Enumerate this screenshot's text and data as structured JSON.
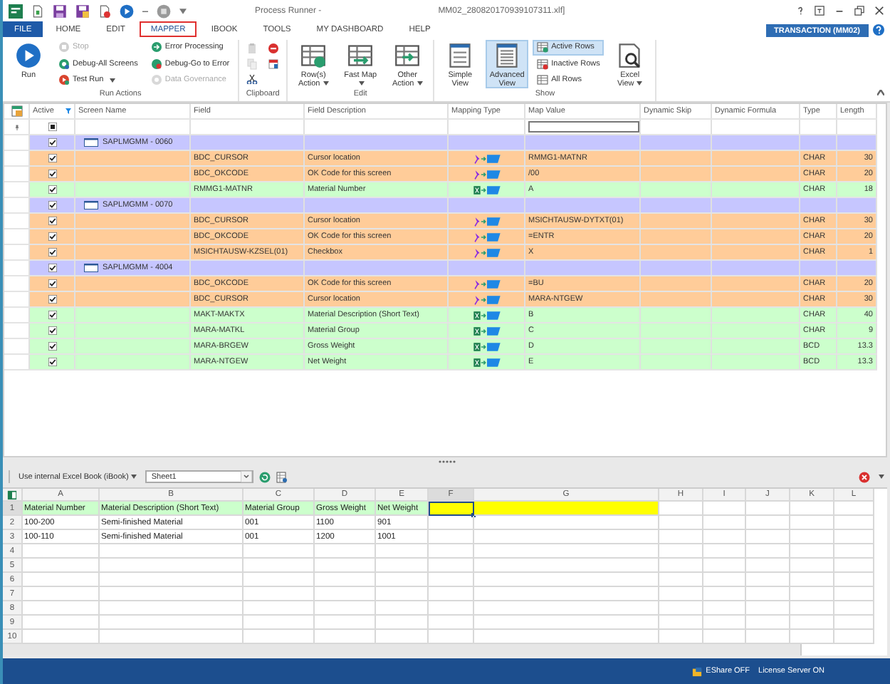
{
  "window": {
    "title": "Process Runner -",
    "document": "MM02_280820170939107311.xlf]"
  },
  "tabs": [
    {
      "label": "FILE",
      "kind": "file",
      "selected": false
    },
    {
      "label": "HOME",
      "kind": "tab",
      "selected": false
    },
    {
      "label": "EDIT",
      "kind": "tab",
      "selected": false
    },
    {
      "label": "MAPPER",
      "kind": "tab",
      "selected": true
    },
    {
      "label": "IBOOK",
      "kind": "tab",
      "selected": false
    },
    {
      "label": "TOOLS",
      "kind": "tab",
      "selected": false
    },
    {
      "label": "MY DASHBOARD",
      "kind": "tab",
      "selected": false
    },
    {
      "label": "HELP",
      "kind": "tab",
      "selected": false
    }
  ],
  "transaction": "TRANSACTION (MM02)",
  "ribbon": {
    "groups": [
      {
        "label": "Run Actions",
        "items": [
          {
            "kind": "big",
            "label": "Run"
          },
          {
            "kind": "small",
            "label": "Stop",
            "disabled": true
          },
          {
            "kind": "small",
            "label": "Debug-All Screens",
            "disabled": false
          },
          {
            "kind": "small",
            "label": "Test Run",
            "disabled": false,
            "caret": true
          },
          {
            "kind": "small",
            "label": "Error Processing",
            "disabled": false
          },
          {
            "kind": "small",
            "label": "Debug-Go to Error",
            "disabled": false
          },
          {
            "kind": "small",
            "label": "Data Governance",
            "disabled": true
          }
        ]
      },
      {
        "label": "Clipboard",
        "items": [
          {
            "kind": "icon",
            "disabled": true
          },
          {
            "kind": "icon",
            "disabled": true
          },
          {
            "kind": "icon",
            "disabled": false
          },
          {
            "kind": "icon",
            "disabled": false
          },
          {
            "kind": "icon",
            "disabled": false
          }
        ]
      },
      {
        "label": "Edit",
        "items": [
          {
            "kind": "big",
            "label": "Row(s) Action",
            "caret": true
          },
          {
            "kind": "big",
            "label": "Fast Map",
            "caret": true
          },
          {
            "kind": "big",
            "label": "Other Action",
            "caret": true
          }
        ]
      },
      {
        "label": "Show",
        "items": [
          {
            "kind": "big",
            "label": "Simple View",
            "selected": false
          },
          {
            "kind": "big",
            "label": "Advanced View",
            "selected": true
          },
          {
            "kind": "small",
            "label": "Active Rows",
            "selected": true
          },
          {
            "kind": "small",
            "label": "Inactive Rows",
            "selected": false
          },
          {
            "kind": "small",
            "label": "All Rows",
            "selected": false
          },
          {
            "kind": "big",
            "label": "Excel View",
            "caret": true,
            "selected": false
          }
        ]
      }
    ]
  },
  "grid": {
    "columns": [
      "Active",
      "Screen Name",
      "Field",
      "Field Description",
      "Mapping Type",
      "Map Value",
      "Dynamic Skip",
      "Dynamic Formula",
      "Type",
      "Length"
    ],
    "rows": [
      {
        "kind": "screen",
        "active": true,
        "screen": "SAPLMGMM - 0060"
      },
      {
        "kind": "constant",
        "active": true,
        "field": "BDC_CURSOR",
        "description": "Cursor location",
        "value": "RMMG1-MATNR",
        "type": "CHAR",
        "length": "30"
      },
      {
        "kind": "constant",
        "active": true,
        "field": "BDC_OKCODE",
        "description": "OK Code for this screen",
        "value": "/00",
        "type": "CHAR",
        "length": "20"
      },
      {
        "kind": "excel",
        "active": true,
        "field": "RMMG1-MATNR",
        "description": "Material Number",
        "value": "A",
        "type": "CHAR",
        "length": "18"
      },
      {
        "kind": "screen",
        "active": true,
        "screen": "SAPLMGMM - 0070"
      },
      {
        "kind": "constant",
        "active": true,
        "field": "BDC_CURSOR",
        "description": "Cursor location",
        "value": "MSICHTAUSW-DYTXT(01)",
        "type": "CHAR",
        "length": "30"
      },
      {
        "kind": "constant",
        "active": true,
        "field": "BDC_OKCODE",
        "description": "OK Code for this screen",
        "value": "=ENTR",
        "type": "CHAR",
        "length": "20"
      },
      {
        "kind": "constant",
        "active": true,
        "field": "MSICHTAUSW-KZSEL(01)",
        "description": "Checkbox",
        "value": "X",
        "type": "CHAR",
        "length": "1"
      },
      {
        "kind": "screen",
        "active": true,
        "screen": "SAPLMGMM - 4004"
      },
      {
        "kind": "constant",
        "active": true,
        "field": "BDC_OKCODE",
        "description": "OK Code for this screen",
        "value": "=BU",
        "type": "CHAR",
        "length": "20"
      },
      {
        "kind": "constant",
        "active": true,
        "field": "BDC_CURSOR",
        "description": "Cursor location",
        "value": "MARA-NTGEW",
        "type": "CHAR",
        "length": "30"
      },
      {
        "kind": "excel",
        "active": true,
        "field": "MAKT-MAKTX",
        "description": "Material Description (Short Text)",
        "value": "B",
        "type": "CHAR",
        "length": "40"
      },
      {
        "kind": "excel",
        "active": true,
        "field": "MARA-MATKL",
        "description": "Material Group",
        "value": "C",
        "type": "CHAR",
        "length": "9"
      },
      {
        "kind": "excel",
        "active": true,
        "field": "MARA-BRGEW",
        "description": "Gross Weight",
        "value": "D",
        "type": "BCD",
        "length": "13.3"
      },
      {
        "kind": "excel",
        "active": true,
        "field": "MARA-NTGEW",
        "description": "Net Weight",
        "value": "E",
        "type": "BCD",
        "length": "13.3"
      }
    ]
  },
  "sheet_toolbar": {
    "source": "Use internal Excel Book (iBook)",
    "sheet": "Sheet1"
  },
  "sheet": {
    "columns": [
      {
        "label": "A",
        "selected": false
      },
      {
        "label": "B",
        "selected": false
      },
      {
        "label": "C",
        "selected": false
      },
      {
        "label": "D",
        "selected": false
      },
      {
        "label": "E",
        "selected": false
      },
      {
        "label": "F",
        "selected": true
      },
      {
        "label": "G",
        "selected": false
      },
      {
        "label": "H",
        "selected": false
      },
      {
        "label": "I",
        "selected": false
      },
      {
        "label": "J",
        "selected": false
      },
      {
        "label": "K",
        "selected": false
      },
      {
        "label": "L",
        "selected": false
      }
    ],
    "rows": [
      {
        "number": "1",
        "selected": true,
        "cells": [
          {
            "text": "Material Number",
            "color": "#ccffcc"
          },
          {
            "text": "Material Description (Short Text)",
            "color": "#ccffcc"
          },
          {
            "text": "Material Group",
            "color": "#ccffcc"
          },
          {
            "text": "Gross Weight",
            "color": "#ccffcc"
          },
          {
            "text": "Net Weight",
            "color": "#ccffcc"
          },
          {
            "color": "#ffff00"
          },
          {
            "color": "#ffff00"
          }
        ]
      },
      {
        "number": "2",
        "selected": false,
        "cells": [
          {
            "text": "100-200"
          },
          {
            "text": "Semi-finished Material"
          },
          {
            "text": "001"
          },
          {
            "text": "1100"
          },
          {
            "text": "901"
          }
        ]
      },
      {
        "number": "3",
        "selected": false,
        "cells": [
          {
            "text": "100-110"
          },
          {
            "text": "Semi-finished Material"
          },
          {
            "text": "001"
          },
          {
            "text": "1200"
          },
          {
            "text": "1001"
          }
        ]
      },
      {
        "number": "4",
        "selected": false
      },
      {
        "number": "5",
        "selected": false
      },
      {
        "number": "6",
        "selected": false
      },
      {
        "number": "7",
        "selected": false
      },
      {
        "number": "8",
        "selected": false
      },
      {
        "number": "9",
        "selected": false
      },
      {
        "number": "10",
        "selected": false
      }
    ]
  },
  "status_bar": {
    "eshare": "EShare OFF",
    "license": "License Server ON"
  }
}
